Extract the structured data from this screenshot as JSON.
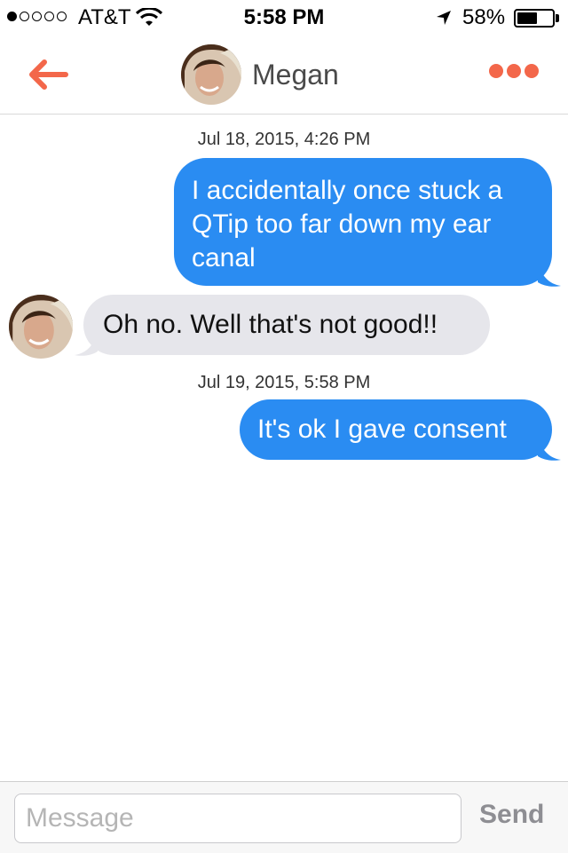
{
  "status_bar": {
    "carrier": "AT&T",
    "time": "5:58 PM",
    "battery_percent": "58%",
    "battery_level": 0.58,
    "signal_bars_filled": 1,
    "signal_bars_total": 5
  },
  "nav": {
    "back_icon": "back-arrow-icon",
    "contact_name": "Megan",
    "more_icon": "more-dots-icon",
    "accent_color": "#f3674a"
  },
  "messages": [
    {
      "timestamp": "Jul 18, 2015, 4:26 PM"
    },
    {
      "direction": "sent",
      "text": "I accidentally once stuck a QTip too far down my ear canal"
    },
    {
      "direction": "received",
      "text": "Oh no. Well that's not good!!"
    },
    {
      "timestamp": "Jul 19, 2015, 5:58 PM"
    },
    {
      "direction": "sent",
      "text": "It's ok I gave consent"
    }
  ],
  "colors": {
    "sent_bubble": "#2a8cf2",
    "received_bubble": "#e6e6eb"
  },
  "input": {
    "placeholder": "Message",
    "value": "",
    "send_label": "Send"
  }
}
